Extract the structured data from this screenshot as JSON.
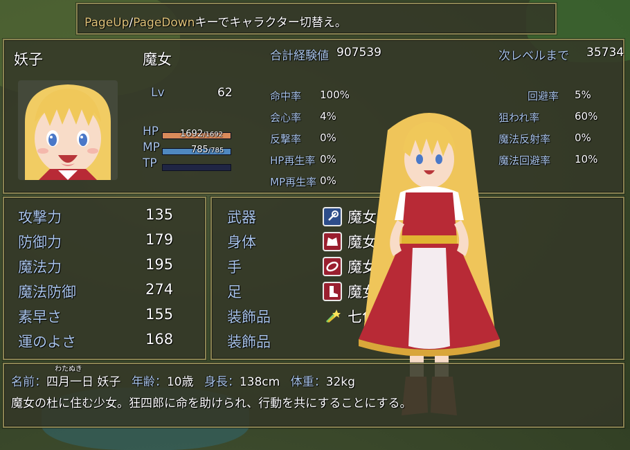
{
  "help": {
    "key1": "PageUp",
    "sep": "/",
    "key2": "PageDown",
    "text": "キーでキャラクター切替え。"
  },
  "status": {
    "name": "妖子",
    "class": "魔女",
    "level_label": "Lv",
    "level": "62",
    "hp_label": "HP",
    "hp_value": "1692",
    "hp_max": "/1692",
    "hp_ratio": 1.0,
    "mp_label": "MP",
    "mp_value": "785",
    "mp_max": "/785",
    "mp_ratio": 1.0,
    "tp_label": "TP",
    "tp_ratio": 0.0,
    "exp_label": "合計経験値",
    "exp_value": "907539",
    "next_label": "次レベルまで",
    "next_value": "35734"
  },
  "rates_left": [
    {
      "label": "命中率",
      "value": "100%"
    },
    {
      "label": "会心率",
      "value": "4%"
    },
    {
      "label": "反撃率",
      "value": "0%"
    },
    {
      "label": "HP再生率",
      "value": "0%"
    },
    {
      "label": "MP再生率",
      "value": "0%"
    }
  ],
  "rates_right": [
    {
      "label": "回避率",
      "value": "5%"
    },
    {
      "label": "狙われ率",
      "value": "60%"
    },
    {
      "label": "魔法反射率",
      "value": "0%"
    },
    {
      "label": "魔法回避率",
      "value": "10%"
    }
  ],
  "params": [
    {
      "label": "攻撃力",
      "value": "135"
    },
    {
      "label": "防御力",
      "value": "179"
    },
    {
      "label": "魔法力",
      "value": "195"
    },
    {
      "label": "魔法防御",
      "value": "274"
    },
    {
      "label": "素早さ",
      "value": "155"
    },
    {
      "label": "運のよさ",
      "value": "168"
    }
  ],
  "equips": [
    {
      "slot": "武器",
      "item": "魔女のつえ",
      "icon": "wand-icon"
    },
    {
      "slot": "身体",
      "item": "魔女のふく",
      "icon": "robe-icon"
    },
    {
      "slot": "手",
      "item": "魔女のうでわ",
      "icon": "bracelet-icon"
    },
    {
      "slot": "足",
      "item": "魔女のくつ",
      "icon": "boots-icon"
    },
    {
      "slot": "装飾品",
      "item": "七色の星飾り",
      "icon": "rainbow-star-icon"
    },
    {
      "slot": "装飾品",
      "item": "",
      "icon": ""
    }
  ],
  "profile": {
    "ruby": "わたぬき",
    "line1_a": "名前：",
    "line1_b": "四月一日 妖子",
    "line1_c": "年齢：",
    "line1_d": "10歳",
    "line1_e": "身長：",
    "line1_f": "138cm",
    "line1_g": "体重：",
    "line1_h": "32kg",
    "line2": "魔女の杜に住む少女。狂四郎に命を助けられ、行動を共にすることにする。"
  },
  "colors": {
    "hp_gauge": "#d98a5a",
    "mp_gauge": "#4f88c0",
    "tp_gauge": "#3a8a4a",
    "system_text": "#a9c4ea",
    "key_text": "#e0c37a"
  }
}
